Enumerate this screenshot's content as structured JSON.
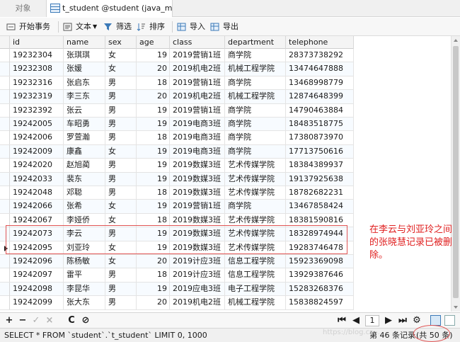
{
  "tabs": [
    {
      "label": "对象"
    },
    {
      "label": "t_student @student (java_m..."
    }
  ],
  "toolbar": {
    "begin_transaction": "开始事务",
    "text": "文本",
    "filter": "筛选",
    "sort": "排序",
    "import": "导入",
    "export": "导出"
  },
  "columns": [
    "id",
    "name",
    "sex",
    "age",
    "class",
    "department",
    "telephone"
  ],
  "rows": [
    [
      "19232304",
      "张琪琪",
      "女",
      "19",
      "2019营销1班",
      "商学院",
      "28373738292"
    ],
    [
      "19232308",
      "张媛",
      "女",
      "20",
      "2019机电2班",
      "机械工程学院",
      "13474647888"
    ],
    [
      "19232316",
      "张启东",
      "男",
      "18",
      "2019营销1班",
      "商学院",
      "13468998779"
    ],
    [
      "19232319",
      "李三东",
      "男",
      "20",
      "2019机电2班",
      "机械工程学院",
      "12874648399"
    ],
    [
      "19232392",
      "张云",
      "男",
      "19",
      "2019营销1班",
      "商学院",
      "14790463884"
    ],
    [
      "19242005",
      "车昭勇",
      "男",
      "19",
      "2019电商3班",
      "商学院",
      "18483518775"
    ],
    [
      "19242006",
      "罗萱瀚",
      "男",
      "18",
      "2019电商3班",
      "商学院",
      "17380873970"
    ],
    [
      "19242009",
      "康鑫",
      "女",
      "19",
      "2019电商3班",
      "商学院",
      "17713750616"
    ],
    [
      "19242020",
      "赵旭蔺",
      "男",
      "19",
      "2019数媒3班",
      "艺术传媒学院",
      "18384389937"
    ],
    [
      "19242033",
      "裴东",
      "男",
      "19",
      "2019数媒3班",
      "艺术传媒学院",
      "19137925638"
    ],
    [
      "19242048",
      "邓聪",
      "男",
      "18",
      "2019数媒3班",
      "艺术传媒学院",
      "18782682231"
    ],
    [
      "19242066",
      "张希",
      "女",
      "19",
      "2019营销1班",
      "商学院",
      "13467858424"
    ],
    [
      "19242067",
      "李娅侨",
      "女",
      "18",
      "2019数媒3班",
      "艺术传媒学院",
      "18381590816"
    ],
    [
      "19242073",
      "李云",
      "男",
      "19",
      "2019数媒3班",
      "艺术传媒学院",
      "18328974944"
    ],
    [
      "19242095",
      "刘亚玲",
      "女",
      "19",
      "2019数媒3班",
      "艺术传媒学院",
      "19283746478"
    ],
    [
      "19242096",
      "陈杨敏",
      "女",
      "20",
      "2019计应3班",
      "信息工程学院",
      "15923369098"
    ],
    [
      "19242097",
      "雷平",
      "男",
      "18",
      "2019计应3班",
      "信息工程学院",
      "13929387646"
    ],
    [
      "19242098",
      "李昆华",
      "男",
      "19",
      "2019应电3班",
      "电子工程学院",
      "15283268376"
    ],
    [
      "19242099",
      "张大东",
      "男",
      "20",
      "2019机电2班",
      "机械工程学院",
      "15838824597"
    ]
  ],
  "annotation": "在李云与刘亚玲之间的张晓慧记录已被删除。",
  "nav": {
    "add": "+",
    "remove": "−",
    "apply": "✓",
    "cancel": "×",
    "refresh": "C",
    "stop": "⊘",
    "first": "⏮",
    "prev": "◀",
    "page": "1",
    "next": "▶",
    "last": "⏭",
    "settings": "⚙"
  },
  "status": {
    "sql": "SELECT * FROM `student`.`t_student` LIMIT 0, 1000",
    "record": "第 46 条记录",
    "total": "(共 50 条)",
    "watermark": "https://blog.cs..."
  },
  "colors": {
    "annotation_red": "#e02020",
    "accent_blue": "#3c7ab8"
  }
}
